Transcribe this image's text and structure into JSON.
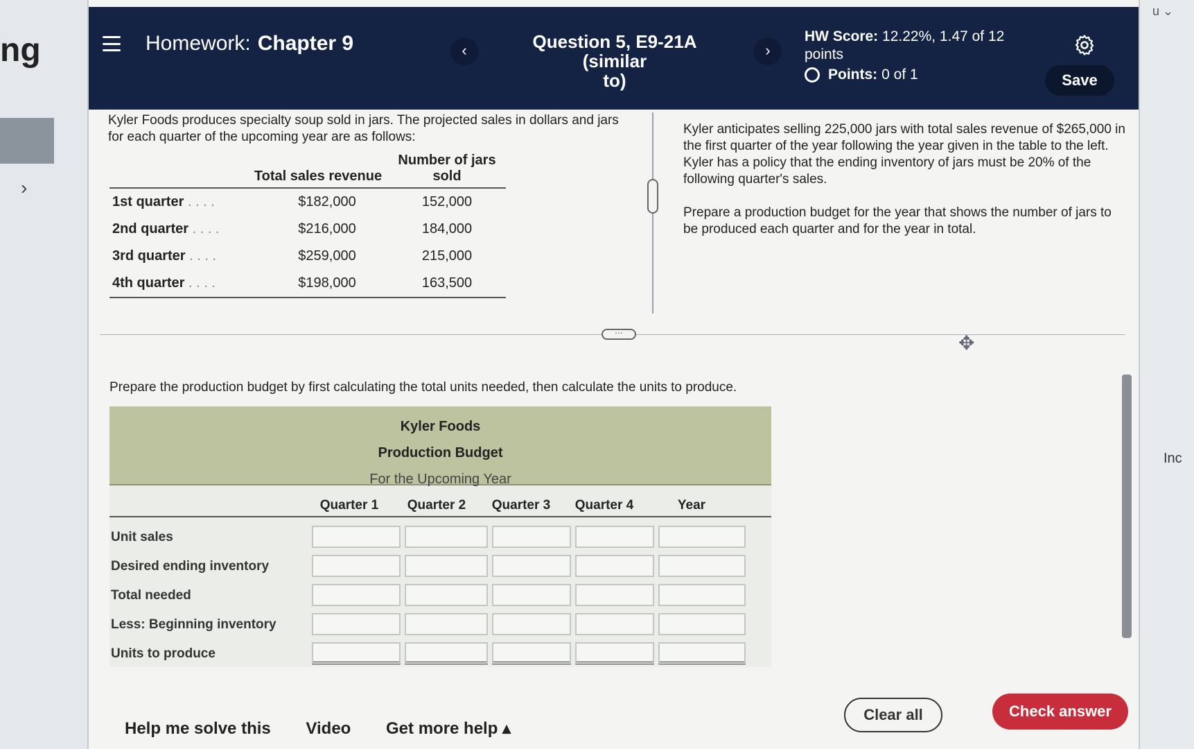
{
  "side": {
    "stub_text": "ng",
    "right_user": "u ⌄",
    "right_inc": "Inc"
  },
  "header": {
    "title_prefix": "Homework:",
    "title_chapter": "Chapter 9",
    "question_line1": "Question 5, E9-21A (similar",
    "question_line2": "to)",
    "score_label": "HW Score:",
    "score_value": "12.22%, 1.47 of 12",
    "score_points_word": "points",
    "points_label": "Points:",
    "points_value": "0 of 1",
    "save_label": "Save"
  },
  "problem": {
    "intro": "Kyler Foods produces specialty soup sold in jars. The projected sales in dollars and jars for each quarter of the upcoming year are as follows:",
    "headers": {
      "revenue": "Total sales revenue",
      "jars": "Number of jars sold"
    },
    "rows": [
      {
        "label": "1st quarter",
        "dots": ". . . .",
        "revenue": "$182,000",
        "jars": "152,000"
      },
      {
        "label": "2nd quarter",
        "dots": ". . . .",
        "revenue": "$216,000",
        "jars": "184,000"
      },
      {
        "label": "3rd quarter",
        "dots": ". . . .",
        "revenue": "$259,000",
        "jars": "215,000"
      },
      {
        "label": "4th quarter",
        "dots": ". . . .",
        "revenue": "$198,000",
        "jars": "163,500"
      }
    ],
    "right_p1": "Kyler anticipates selling 225,000 jars with total sales revenue of $265,000 in the first quarter of the year following the year given in the table to the left. Kyler has a policy that the ending inventory of jars must be 20% of the following quarter's sales.",
    "right_p2": "Prepare a production budget for the year that shows the number of jars to be produced each quarter and for the year in total."
  },
  "instruction": "Prepare the production budget by first calculating the total units needed, then calculate the units to produce.",
  "budget": {
    "company": "Kyler Foods",
    "title": "Production Budget",
    "period": "For the Upcoming Year",
    "columns": [
      "Quarter 1",
      "Quarter 2",
      "Quarter 3",
      "Quarter 4",
      "Year"
    ],
    "rows": [
      "Unit sales",
      "Desired ending inventory",
      "Total needed",
      "Less: Beginning inventory",
      "Units to produce"
    ]
  },
  "footer": {
    "help": "Help me solve this",
    "video": "Video",
    "more_help": "Get more help ▴",
    "clear": "Clear all",
    "check": "Check answer"
  },
  "colors": {
    "header_bg": "#142243",
    "check_button": "#c82d3b",
    "budget_header": "#bcc39e"
  }
}
